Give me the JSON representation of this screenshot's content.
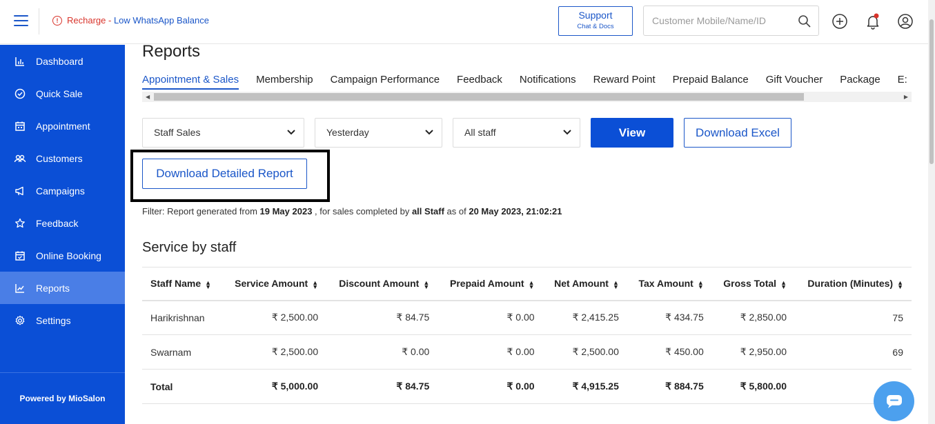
{
  "topbar": {
    "recharge_prefix": "Recharge",
    "recharge_sep": " - ",
    "recharge_link": "Low WhatsApp Balance",
    "support_title": "Support",
    "support_sub": "Chat & Docs",
    "search_placeholder": "Customer Mobile/Name/ID"
  },
  "sidebar": {
    "items": [
      {
        "label": "Dashboard",
        "icon": "bar-chart-icon"
      },
      {
        "label": "Quick Sale",
        "icon": "check-circle-icon"
      },
      {
        "label": "Appointment",
        "icon": "calendar-icon"
      },
      {
        "label": "Customers",
        "icon": "users-icon"
      },
      {
        "label": "Campaigns",
        "icon": "megaphone-icon"
      },
      {
        "label": "Feedback",
        "icon": "star-icon"
      },
      {
        "label": "Online Booking",
        "icon": "calendar-check-icon"
      },
      {
        "label": "Reports",
        "icon": "line-chart-icon"
      },
      {
        "label": "Settings",
        "icon": "gear-icon"
      }
    ],
    "active": "Reports",
    "powered_by": "Powered by MioSalon"
  },
  "page": {
    "title": "Reports",
    "tabs": [
      "Appointment & Sales",
      "Membership",
      "Campaign Performance",
      "Feedback",
      "Notifications",
      "Reward Point",
      "Prepaid Balance",
      "Gift Voucher",
      "Package",
      "E:"
    ],
    "active_tab": "Appointment & Sales"
  },
  "controls": {
    "report_type": "Staff Sales",
    "period": "Yesterday",
    "staff": "All staff",
    "view_label": "View",
    "excel_label": "Download Excel",
    "detailed_label": "Download Detailed Report"
  },
  "filter": {
    "p1": "Filter: Report generated from ",
    "from_date": "19 May 2023",
    "p2": " , for sales completed by ",
    "staff": "all Staff",
    "p3": " as of ",
    "as_of": "20 May 2023, 21:02:21"
  },
  "section_title": "Service by staff",
  "table": {
    "headers": [
      "Staff Name",
      "Service Amount",
      "Discount Amount",
      "Prepaid Amount",
      "Net Amount",
      "Tax Amount",
      "Gross Total",
      "Duration (Minutes)"
    ],
    "rows": [
      [
        "Harikrishnan",
        "₹ 2,500.00",
        "₹ 84.75",
        "₹ 0.00",
        "₹ 2,415.25",
        "₹ 434.75",
        "₹ 2,850.00",
        "75"
      ],
      [
        "Swarnam",
        "₹ 2,500.00",
        "₹ 0.00",
        "₹ 0.00",
        "₹ 2,500.00",
        "₹ 450.00",
        "₹ 2,950.00",
        "69"
      ]
    ],
    "total": [
      "Total",
      "₹ 5,000.00",
      "₹ 84.75",
      "₹ 0.00",
      "₹ 4,915.25",
      "₹ 884.75",
      "₹ 5,800.00",
      ""
    ]
  },
  "colors": {
    "brand": "#0b4fd6",
    "accent_text": "#1a56c8",
    "warning": "#d9342b",
    "chat": "#4ca0ee"
  }
}
